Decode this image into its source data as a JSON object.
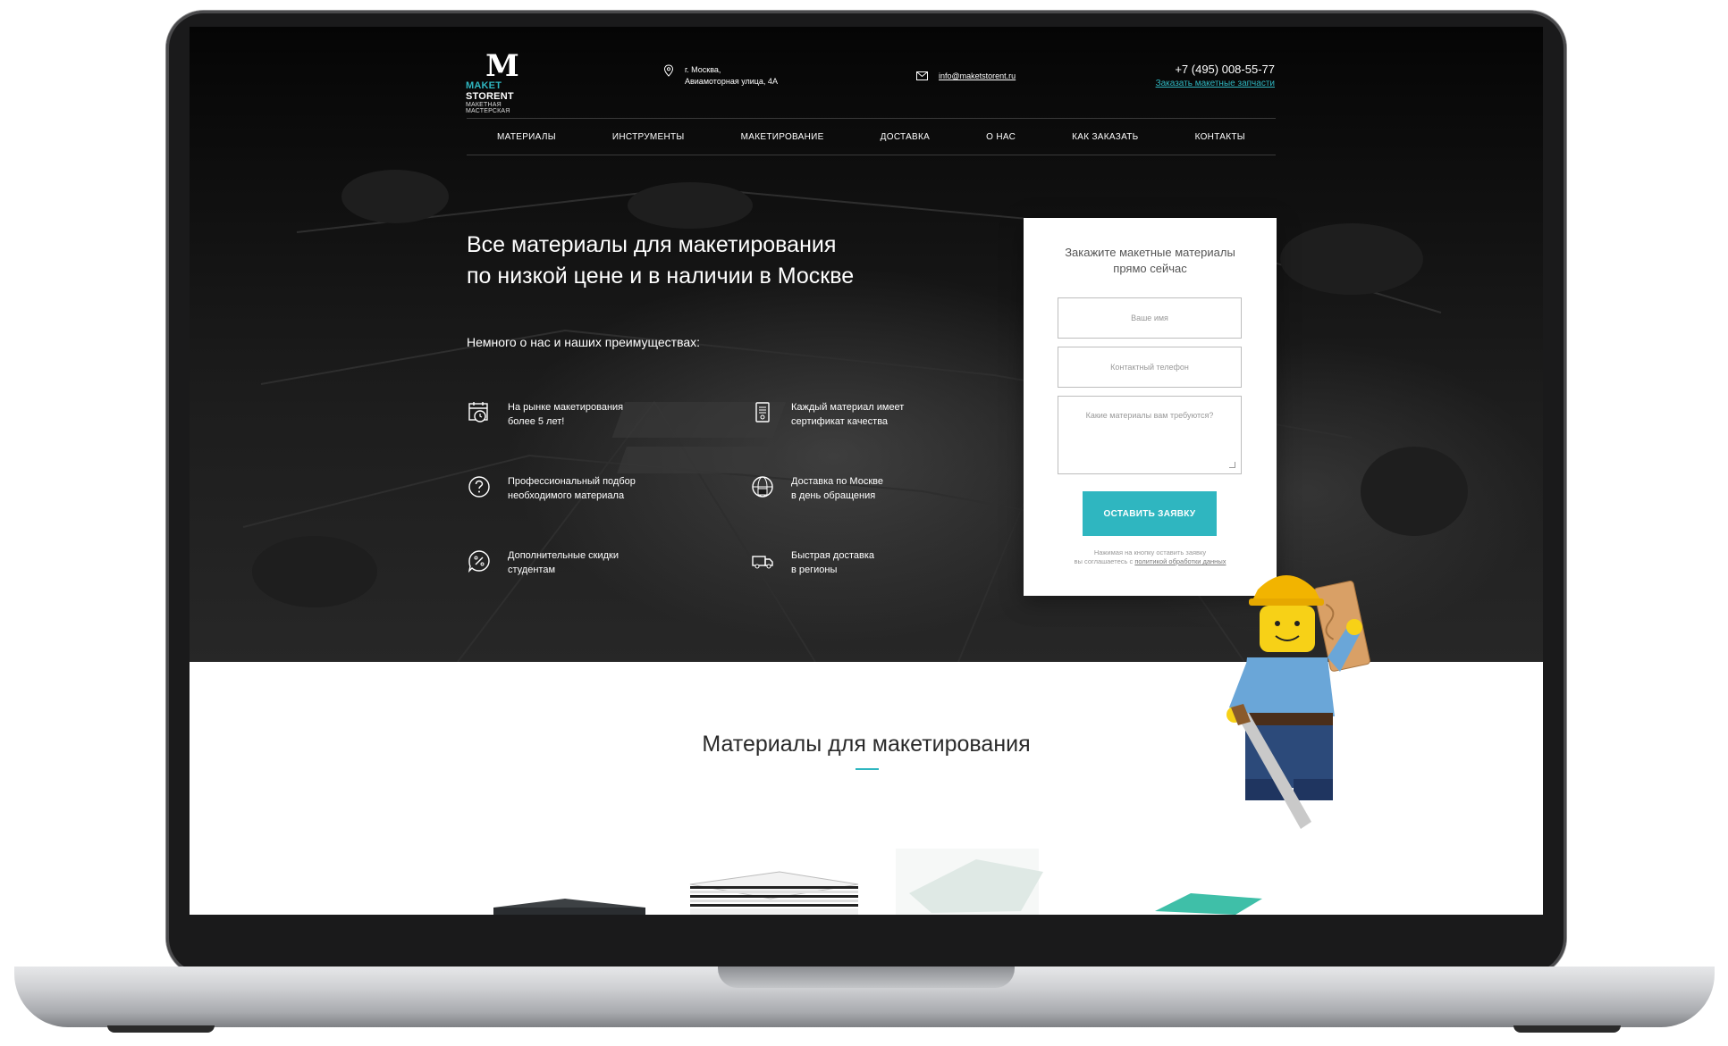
{
  "header": {
    "logo": {
      "mark": "M",
      "brand_accent": "MAKET",
      "brand_rest": " STORENT",
      "subtitle": "МАКЕТНАЯ МАСТЕРСКАЯ"
    },
    "address_line1": "г. Москва,",
    "address_line2": "Авиамоторная улица, 4А",
    "email": "info@maketstorent.ru",
    "phone": "+7 (495) 008-55-77",
    "phone_link": "Заказать макетные запчасти"
  },
  "nav": [
    "МАТЕРИАЛЫ",
    "ИНСТРУМЕНТЫ",
    "МАКЕТИРОВАНИЕ",
    "ДОСТАВКА",
    "О НАС",
    "КАК ЗАКАЗАТЬ",
    "КОНТАКТЫ"
  ],
  "hero": {
    "title_line1": "Все материалы для макетирования",
    "title_line2": "по низкой цене и в наличии в Москве",
    "subtitle": "Немного о нас и наших преимуществах:",
    "features": [
      {
        "icon": "calendar-clock-icon",
        "text": "На рынке макетирования\nболее 5 лет!"
      },
      {
        "icon": "certificate-icon",
        "text": "Каждый материал имеет\nсертификат качества"
      },
      {
        "icon": "question-circle-icon",
        "text": "Профессиональный подбор\nнеобходимого материала"
      },
      {
        "icon": "globe-delivery-icon",
        "text": "Доставка по Москве\nв день обращения"
      },
      {
        "icon": "discount-badge-icon",
        "text": "Дополнительные скидки\nстудентам"
      },
      {
        "icon": "truck-icon",
        "text": "Быстрая доставка\nв регионы"
      }
    ]
  },
  "form": {
    "title": "Закажите макетные материалы\nпрямо сейчас",
    "name_placeholder": "Ваше имя",
    "phone_placeholder": "Контактный телефон",
    "message_placeholder": "Какие материалы вам требуются?",
    "submit": "ОСТАВИТЬ ЗАЯВКУ",
    "agree_line1": "Нажимая на кнопку оставить заявку",
    "agree_prefix": "вы соглашаетесь с ",
    "agree_link": "политикой обработки данных"
  },
  "section": {
    "title": "Материалы для макетирования"
  },
  "colors": {
    "accent": "#2fb6c0",
    "hero_bg": "#111111",
    "text_dark": "#2a2a2a"
  }
}
